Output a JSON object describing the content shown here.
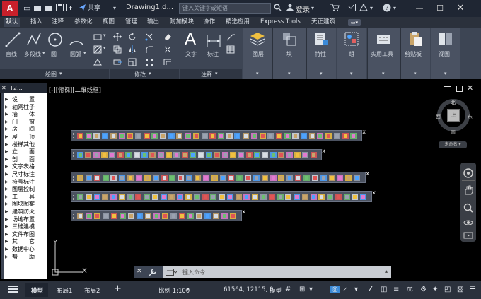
{
  "app": {
    "logo": "A",
    "title": "Drawing1.d...",
    "search_placeholder": "键入关键字或短语",
    "login": "登录",
    "share": "共享"
  },
  "tabs": [
    "默认",
    "插入",
    "注释",
    "参数化",
    "视图",
    "管理",
    "输出",
    "附加模块",
    "协作",
    "精选应用",
    "Express Tools",
    "天正建筑"
  ],
  "ribbon": {
    "draw_tools": [
      "直线",
      "多段线",
      "圆",
      "圆弧"
    ],
    "tools_2": [
      "文字",
      "标注"
    ],
    "panels_right": [
      "图层",
      "块",
      "特性",
      "组",
      "实用工具",
      "剪贴板",
      "视图"
    ],
    "panel_names": [
      "绘图",
      "修改",
      "注释"
    ]
  },
  "side_panel": {
    "header": "T2...",
    "items": [
      "设　　置",
      "轴网柱子",
      "墙　　体",
      "门　　窗",
      "房　　间",
      "屋　　顶",
      "楼梯其他",
      "立　　面",
      "剖　　面",
      "文字表格",
      "尺寸标注",
      "符号标注",
      "图层控制",
      "工　　具",
      "图块图案",
      "建筑防火",
      "场地布置",
      "三维建模",
      "文件布图",
      "其　　它",
      "数据中心",
      "帮　　助"
    ]
  },
  "viewport": {
    "label": "[-][俯视][二维线框]"
  },
  "viewcube": {
    "north": "北",
    "south": "南",
    "east": "东",
    "west": "西",
    "top": "上",
    "wcs": "未命名"
  },
  "command": {
    "placeholder": "键入命令"
  },
  "statusbar": {
    "model_tab": "模型",
    "layout1": "布局1",
    "layout2": "布局2",
    "scale": "比例 1:100",
    "coords": "61564, 12115, 0",
    "mode": "模型"
  },
  "colors": {
    "titlebar": "#1f2633",
    "ribbon": "#3d4554",
    "logo": "#c8202b",
    "accent": "#3b8ad8"
  }
}
